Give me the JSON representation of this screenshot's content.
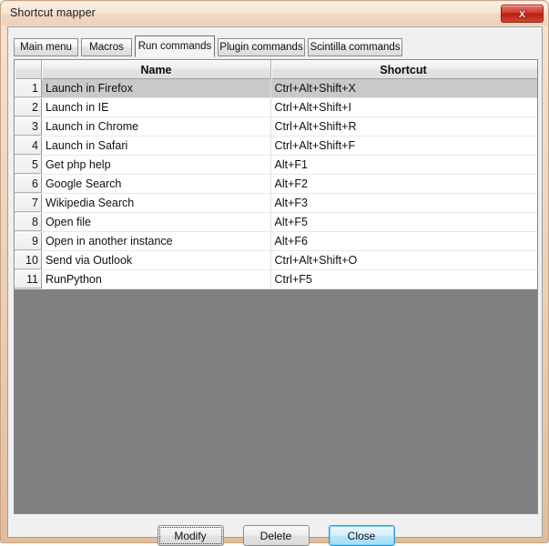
{
  "window": {
    "title": "Shortcut mapper",
    "close_icon": "close-x-icon",
    "close_label": "Close window"
  },
  "tabs": [
    {
      "label": "Main menu",
      "selected": false
    },
    {
      "label": "Macros",
      "selected": false
    },
    {
      "label": "Run commands",
      "selected": true
    },
    {
      "label": "Plugin commands",
      "selected": false
    },
    {
      "label": "Scintilla commands",
      "selected": false
    }
  ],
  "table": {
    "columns": [
      "",
      "Name",
      "Shortcut"
    ],
    "selected_row": 1,
    "rows": [
      {
        "index": "1",
        "name": "Launch in Firefox",
        "shortcut": "Ctrl+Alt+Shift+X"
      },
      {
        "index": "2",
        "name": "Launch in IE",
        "shortcut": "Ctrl+Alt+Shift+I"
      },
      {
        "index": "3",
        "name": "Launch in Chrome",
        "shortcut": "Ctrl+Alt+Shift+R"
      },
      {
        "index": "4",
        "name": "Launch in Safari",
        "shortcut": "Ctrl+Alt+Shift+F"
      },
      {
        "index": "5",
        "name": "Get php help",
        "shortcut": "Alt+F1"
      },
      {
        "index": "6",
        "name": "Google Search",
        "shortcut": "Alt+F2"
      },
      {
        "index": "7",
        "name": "Wikipedia Search",
        "shortcut": "Alt+F3"
      },
      {
        "index": "8",
        "name": "Open file",
        "shortcut": "Alt+F5"
      },
      {
        "index": "9",
        "name": "Open in another instance",
        "shortcut": "Alt+F6"
      },
      {
        "index": "10",
        "name": "Send via Outlook",
        "shortcut": "Ctrl+Alt+Shift+O"
      },
      {
        "index": "11",
        "name": "RunPython",
        "shortcut": "Ctrl+F5"
      }
    ]
  },
  "footer": {
    "modify_label": "Modify",
    "delete_label": "Delete",
    "close_label": "Close"
  },
  "colors": {
    "title_bar": "#f3ddc8",
    "frame": "#e2bd9c",
    "dialog_bg": "#f0f0f0",
    "list_empty": "#808080",
    "row_selected": "#c9c9c9",
    "default_button_accent": "#2c9fd8",
    "close_button_red": "#c32a17"
  }
}
